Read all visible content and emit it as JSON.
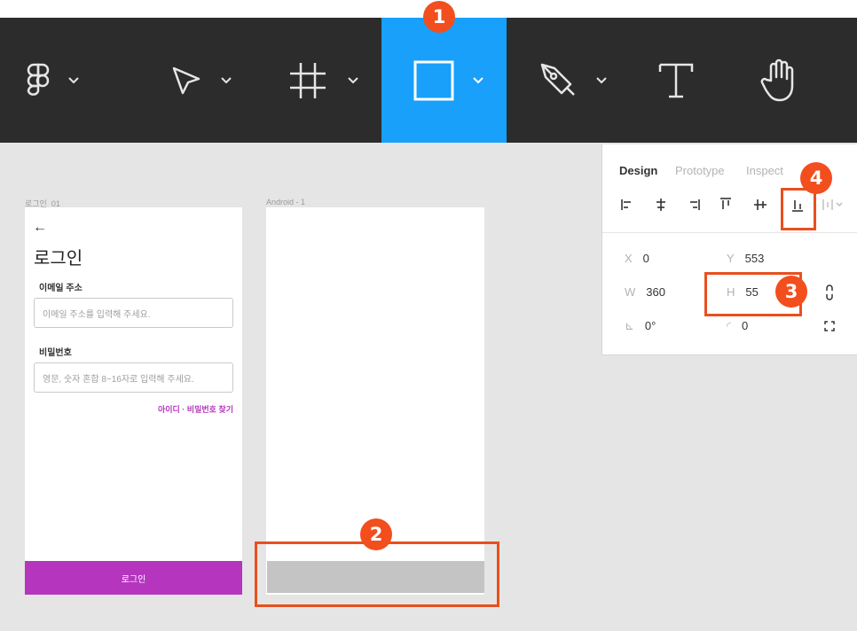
{
  "toolbar": {
    "active_tool": "rectangle",
    "active_color": "#18a0fb",
    "tools": [
      {
        "name": "figma-menu",
        "icon": "figma-logo-icon",
        "has_dropdown": true
      },
      {
        "name": "move",
        "icon": "cursor-icon",
        "has_dropdown": true
      },
      {
        "name": "frame",
        "icon": "frame-icon",
        "has_dropdown": true
      },
      {
        "name": "rectangle",
        "icon": "rectangle-icon",
        "has_dropdown": true
      },
      {
        "name": "pen",
        "icon": "pen-icon",
        "has_dropdown": true
      },
      {
        "name": "text",
        "icon": "text-icon",
        "has_dropdown": false
      },
      {
        "name": "hand",
        "icon": "hand-icon",
        "has_dropdown": false
      }
    ]
  },
  "badges": {
    "b1": "1",
    "b2": "2",
    "b3": "3",
    "b4": "4"
  },
  "annotation_color": "#e8501e",
  "canvas": {
    "frame1": {
      "label": "로그인_01",
      "back_arrow": "←",
      "title": "로그인",
      "email_label": "이메일 주소",
      "email_placeholder": "이메일 주소를 입력해 주세요.",
      "password_label": "비밀번호",
      "password_placeholder": "영문, 숫자 혼합 8~16자로 입력해 주세요.",
      "find_link": "아이디 · 비밀번호 찾기",
      "login_button": "로그인",
      "brand_color": "#b535bf"
    },
    "frame2": {
      "label": "Android - 1",
      "bottom_rect_color": "#c4c4c4"
    }
  },
  "panel": {
    "tabs": [
      "Design",
      "Prototype",
      "Inspect"
    ],
    "active_tab": "Design",
    "props": {
      "x_label": "X",
      "x": "0",
      "y_label": "Y",
      "y": "553",
      "w_label": "W",
      "w": "360",
      "h_label": "H",
      "h": "55",
      "rotation_label": "⊾",
      "rotation": "0°",
      "radius_label": "◜",
      "radius": "0"
    }
  }
}
